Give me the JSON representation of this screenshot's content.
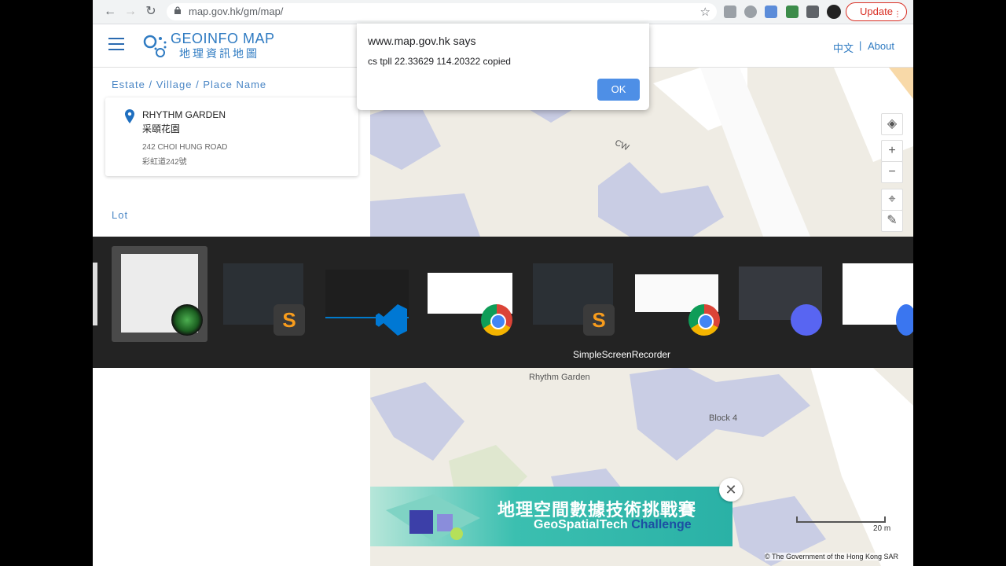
{
  "browser": {
    "url": "map.gov.hk/gm/map/",
    "update_label": "Update"
  },
  "header": {
    "title": "GEOINFO MAP",
    "subtitle": "地理資訊地圖",
    "lang_label": "中文",
    "separator": "|",
    "about_label": "About"
  },
  "panel": {
    "section_estate": "Estate / Village / Place Name",
    "result": {
      "name": "RHYTHM GARDEN",
      "name_zh": "采頤花園",
      "address": "242 CHOI HUNG ROAD",
      "address_zh": "彩虹道242號"
    },
    "section_lot": "Lot"
  },
  "dialog": {
    "title": "www.map.gov.hk says",
    "message": "cs tpll 22.33629 114.20322 copied",
    "ok_label": "OK"
  },
  "map": {
    "label_cw": "CW",
    "label_rhythm": "Rhythm Garden",
    "label_block": "Block 4",
    "scale_label": "20 m",
    "copyright": "© The Government of the Hong Kong SAR"
  },
  "switcher": {
    "selected_label": "SimpleScreenRecorder"
  },
  "banner": {
    "title_zh": "地理空間數據技術挑戰賽",
    "title_en_1": "GeoSpatialTech ",
    "title_en_2": "Challenge"
  }
}
